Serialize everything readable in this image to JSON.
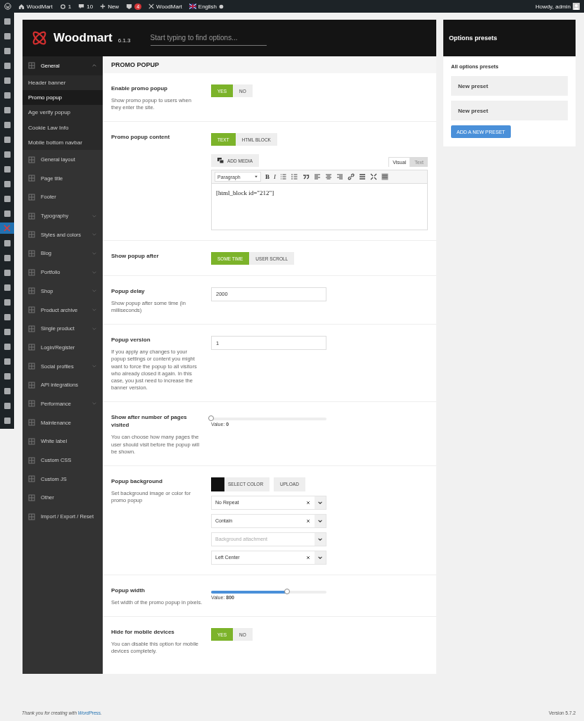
{
  "admin_bar": {
    "site": "WoodMart",
    "updates": "1",
    "comments": "10",
    "new": "New",
    "notifications": "4",
    "woodmart": "WoodMart",
    "language": "English",
    "greeting": "Howdy, admin"
  },
  "admin_menu": [
    {
      "selected": false
    },
    {
      "selected": false
    },
    {
      "selected": false
    },
    {
      "selected": false
    },
    {
      "selected": false
    },
    {
      "selected": false
    },
    {
      "selected": false
    },
    {
      "selected": false
    },
    {
      "selected": false
    },
    {
      "selected": false
    },
    {
      "selected": false
    },
    {
      "selected": false
    },
    {
      "selected": false
    },
    {
      "selected": false
    },
    {
      "selected": true
    },
    {
      "selected": false
    },
    {
      "selected": false
    },
    {
      "selected": false
    },
    {
      "selected": false
    },
    {
      "selected": false
    },
    {
      "selected": false
    },
    {
      "selected": false
    },
    {
      "selected": false
    },
    {
      "selected": false
    },
    {
      "selected": false
    },
    {
      "selected": false
    },
    {
      "selected": false
    },
    {
      "selected": false
    }
  ],
  "header": {
    "logo": "Woodmart",
    "version": "6.1.3",
    "search_placeholder": "Start typing to find options..."
  },
  "sidebar": [
    {
      "label": "General",
      "has_children": true,
      "expanded": true,
      "children": [
        {
          "label": "Header banner",
          "selected": false
        },
        {
          "label": "Promo popup",
          "selected": true
        },
        {
          "label": "Age verify popup",
          "selected": false
        },
        {
          "label": "Cookie Law Info",
          "selected": false
        },
        {
          "label": "Mobile bottom navbar",
          "selected": false
        }
      ]
    },
    {
      "label": "General layout",
      "has_children": false,
      "expanded": false
    },
    {
      "label": "Page title",
      "has_children": false,
      "expanded": false
    },
    {
      "label": "Footer",
      "has_children": false,
      "expanded": false
    },
    {
      "label": "Typography",
      "has_children": true,
      "expanded": false
    },
    {
      "label": "Styles and colors",
      "has_children": true,
      "expanded": false
    },
    {
      "label": "Blog",
      "has_children": true,
      "expanded": false
    },
    {
      "label": "Portfolio",
      "has_children": true,
      "expanded": false
    },
    {
      "label": "Shop",
      "has_children": true,
      "expanded": false
    },
    {
      "label": "Product archive",
      "has_children": true,
      "expanded": false
    },
    {
      "label": "Single product",
      "has_children": true,
      "expanded": false
    },
    {
      "label": "Login/Register",
      "has_children": false,
      "expanded": false
    },
    {
      "label": "Social profiles",
      "has_children": true,
      "expanded": false
    },
    {
      "label": "API integrations",
      "has_children": false,
      "expanded": false
    },
    {
      "label": "Performance",
      "has_children": true,
      "expanded": false
    },
    {
      "label": "Maintenance",
      "has_children": false,
      "expanded": false
    },
    {
      "label": "White label",
      "has_children": false,
      "expanded": false
    },
    {
      "label": "Custom CSS",
      "has_children": false,
      "expanded": false
    },
    {
      "label": "Custom JS",
      "has_children": false,
      "expanded": false
    },
    {
      "label": "Other",
      "has_children": false,
      "expanded": false
    },
    {
      "label": "Import / Export / Reset",
      "has_children": false,
      "expanded": false
    }
  ],
  "section_title": "PROMO POPUP",
  "fields": [
    {
      "kind": "switch",
      "title": "Enable promo popup",
      "description": "Show promo popup to users when they enter the site.",
      "options": [
        {
          "label": "YES",
          "selected": true
        },
        {
          "label": "NO",
          "selected": false
        }
      ]
    },
    {
      "kind": "editor",
      "title": "Promo popup content",
      "options": [
        {
          "label": "TEXT",
          "selected": true
        },
        {
          "label": "HTML BLOCK",
          "selected": false
        }
      ],
      "add_media": "ADD MEDIA",
      "tabs": [
        {
          "label": "Visual",
          "selected": true
        },
        {
          "label": "Text",
          "selected": false
        }
      ],
      "format": "Paragraph",
      "toolbar_glyphs": [
        "B",
        "I"
      ],
      "content": "[html_block id=\"212\"]"
    },
    {
      "kind": "switch",
      "title": "Show popup after",
      "options": [
        {
          "label": "SOME TIME",
          "selected": true
        },
        {
          "label": "USER SCROLL",
          "selected": false
        }
      ]
    },
    {
      "kind": "input",
      "title": "Popup delay",
      "description": "Show popup after some time (in milliseconds)",
      "value": "2000"
    },
    {
      "kind": "input",
      "title": "Popup version",
      "description": "If you apply any changes to your popup settings or content you might want to force the popup to all visitors who already closed it again. In this case, you just need to increase the banner version.",
      "value": "1"
    },
    {
      "kind": "slider",
      "title": "Show after number of pages visited",
      "description": "You can choose how many pages the user should visit before the popup will be shown.",
      "level": 0,
      "reading": "Value: **0**"
    },
    {
      "kind": "background",
      "title": "Popup background",
      "description": "Set background image or color for promo popup",
      "color": "#111111",
      "select_color": "SELECT COLOR",
      "upload": "UPLOAD",
      "selects": [
        {
          "value": "No Repeat"
        },
        {
          "value": "Contain"
        },
        {
          "placeholder": "Background attachment"
        },
        {
          "value": "Left Center"
        }
      ]
    },
    {
      "kind": "slider",
      "title": "Popup width",
      "description": "Set width of the promo popup in pixels.",
      "level": 0.66,
      "reading": "Value: **800**"
    },
    {
      "kind": "switch",
      "title": "Hide for mobile devices",
      "description": "You can disable this option for mobile devices completely.",
      "options": [
        {
          "label": "YES",
          "selected": true
        },
        {
          "label": "NO",
          "selected": false
        }
      ]
    }
  ],
  "presets": {
    "title": "Options presets",
    "subtitle": "All options presets",
    "items": [
      "New preset",
      "New preset"
    ],
    "button": "ADD A NEW PRESET"
  },
  "footer": {
    "credit_prefix": "Thank you for creating with",
    "credit_link": "WordPress",
    "credit_suffix": ".",
    "version": "Version 5.7.2"
  }
}
